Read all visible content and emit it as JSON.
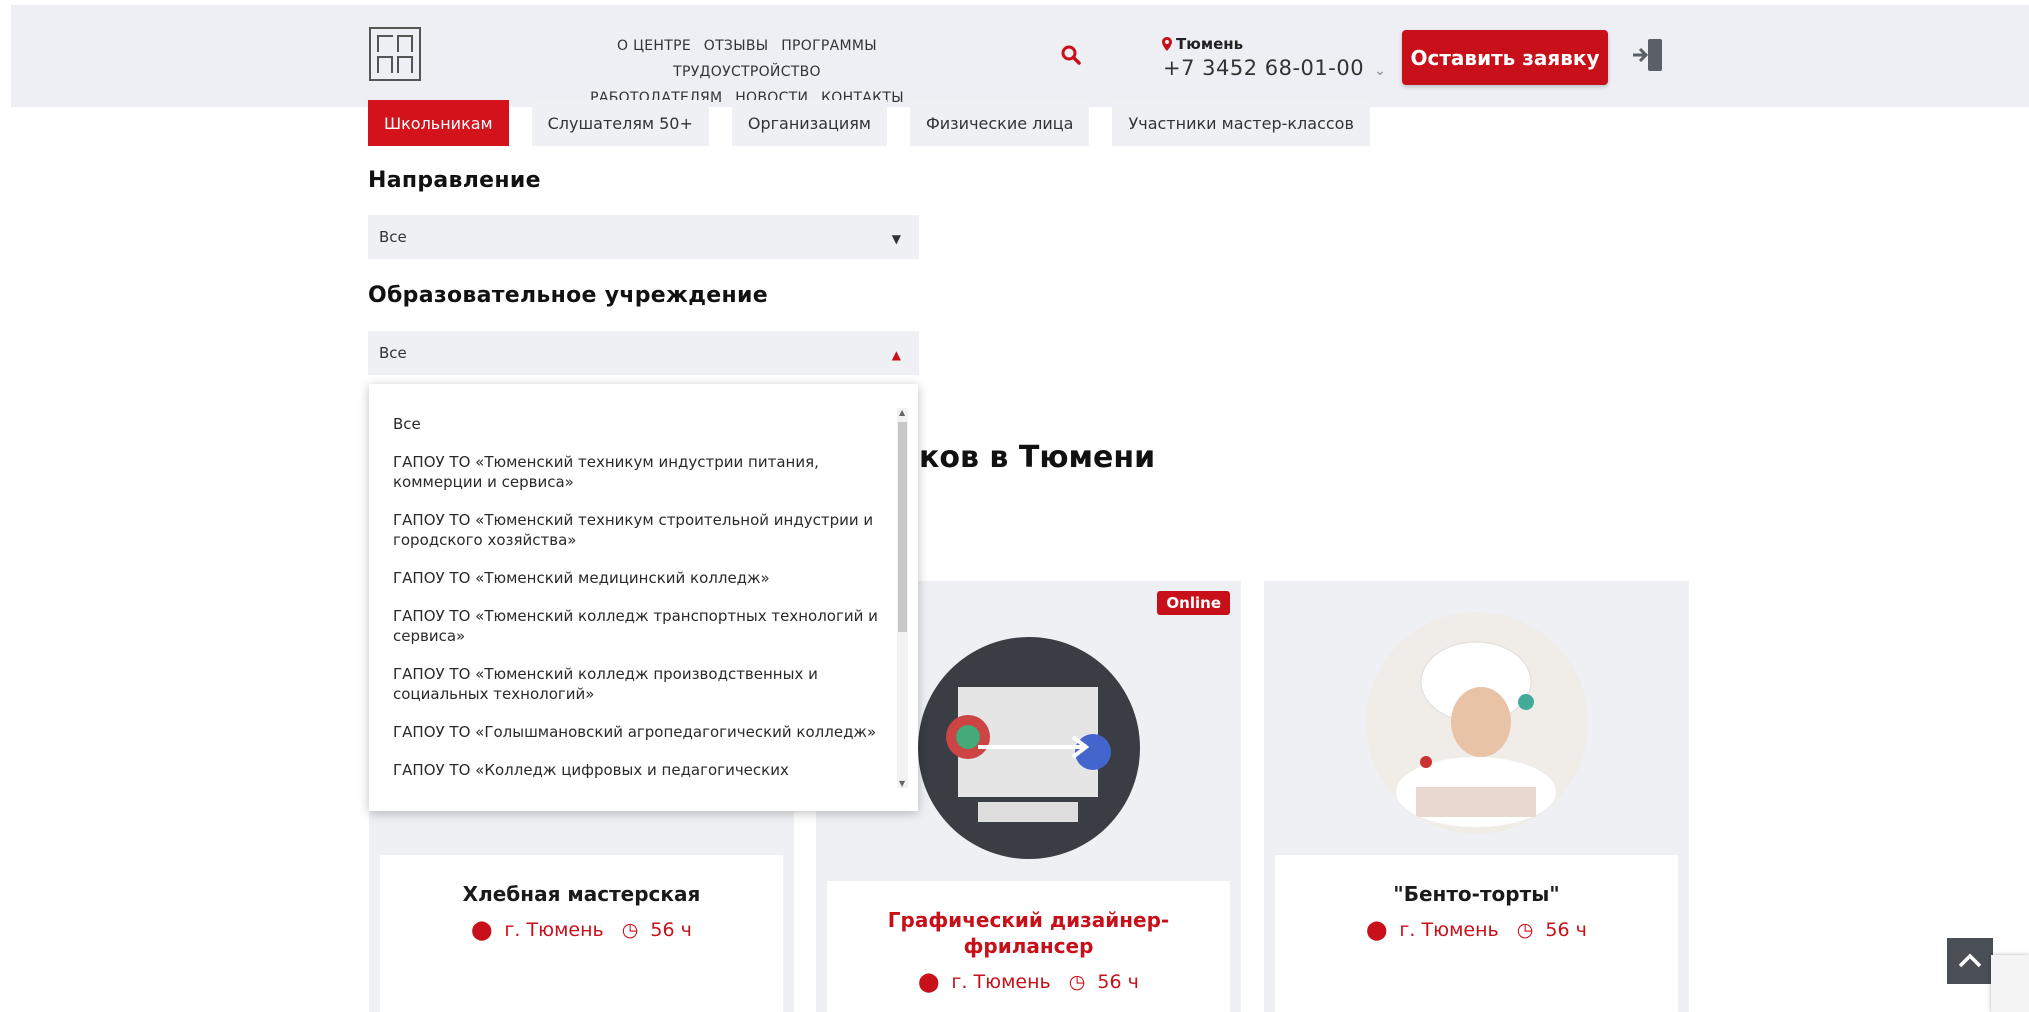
{
  "header": {
    "nav_row1": [
      "О центре",
      "Отзывы",
      "Программы",
      "Трудоустройство"
    ],
    "nav_row2": [
      "Работодателям",
      "Новости",
      "Контакты"
    ],
    "city": "Тюмень",
    "phone": "+7 3452 68-01-00",
    "cta_label": "Оставить заявку"
  },
  "tabs": [
    {
      "label": "Школьникам",
      "active": true
    },
    {
      "label": "Слушателям 50+"
    },
    {
      "label": "Организациям"
    },
    {
      "label": "Физические лица"
    },
    {
      "label": "Участники мастер-классов"
    }
  ],
  "filters": {
    "direction_label": "Направление",
    "direction_value": "Все",
    "institution_label": "Образовательное учреждение",
    "institution_value": "Все"
  },
  "dropdown": {
    "options": [
      "Все",
      "ГАПОУ ТО «Тюменский техникум индустрии питания, коммерции и сервиса»",
      "ГАПОУ ТО «Тюменский техникум строительной индустрии и городского хозяйства»",
      "ГАПОУ ТО «Тюменский медицинский колледж»",
      "ГАПОУ ТО «Тюменский колледж транспортных технологий и сервиса»",
      "ГАПОУ ТО «Тюменский колледж производственных и социальных технологий»",
      "ГАПОУ ТО «Голышмановский агропедагогический колледж»",
      "ГАПОУ ТО «Колледж цифровых и педагогических"
    ]
  },
  "section": {
    "title_partial": "иков в Тюмени"
  },
  "cards": [
    {
      "title": "Хлебная мастерская",
      "city": "г. Тюмень",
      "hours": "56 ч",
      "online": false
    },
    {
      "title": "Графический дизайнер-фрилансер",
      "city": "г. Тюмень",
      "hours": "56 ч",
      "online": true,
      "badge": "Online"
    },
    {
      "title": "\"Бенто-торты\"",
      "city": "г. Тюмень",
      "hours": "56 ч",
      "online": false
    }
  ],
  "colors": {
    "accent": "#c8101a",
    "panel": "#eef0f4"
  }
}
